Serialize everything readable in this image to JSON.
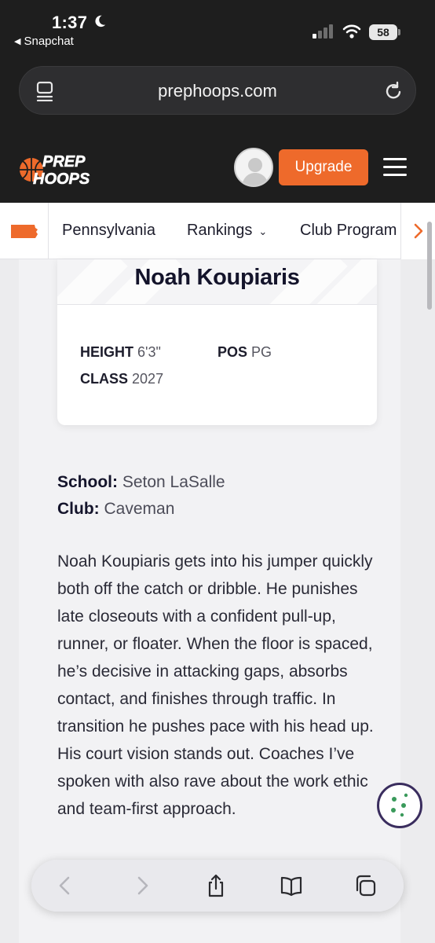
{
  "status_bar": {
    "time": "1:37",
    "back_app": "Snapchat",
    "battery": "58"
  },
  "browser": {
    "url": "prephoops.com"
  },
  "header": {
    "logo_line1": "PREP",
    "logo_line2": "HOOPS",
    "upgrade_label": "Upgrade",
    "accent_color": "#ee6a2b"
  },
  "state_nav": {
    "items": [
      {
        "label": "Pennsylvania"
      },
      {
        "label": "Rankings"
      },
      {
        "label": "Club Program"
      }
    ]
  },
  "player": {
    "name": "Noah Koupiaris",
    "height_label": "HEIGHT",
    "height": "6'3\"",
    "pos_label": "POS",
    "pos": "PG",
    "class_label": "CLASS",
    "class": "2027",
    "school_label": "School:",
    "school": "Seton LaSalle",
    "club_label": "Club:",
    "club": "Caveman",
    "bio": "Noah Koupiaris gets into his jumper quickly both off the catch or dribble. He punishes late closeouts with a confident pull-up, runner, or floater. When the floor is spaced, he’s decisive in attacking gaps, absorbs contact, and finishes through traffic. In transition he pushes pace with his head up. His court vision stands out. Coaches I’ve spoken with also rave about the work ethic and team-first approach."
  }
}
